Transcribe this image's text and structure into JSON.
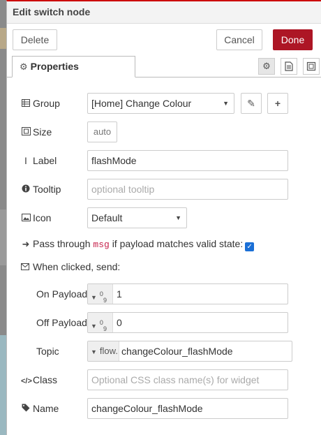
{
  "tray": {
    "title": "Edit switch node"
  },
  "toolbar": {
    "delete_label": "Delete",
    "cancel_label": "Cancel",
    "done_label": "Done"
  },
  "tabs": {
    "properties_label": "Properties",
    "icons": [
      "gear-icon",
      "description-icon",
      "appearance-icon"
    ]
  },
  "form": {
    "group": {
      "label": "Group",
      "value": "[Home] Change Colour"
    },
    "size": {
      "label": "Size",
      "value": "auto"
    },
    "label": {
      "label": "Label",
      "value": "flashMode"
    },
    "tooltip": {
      "label": "Tooltip",
      "placeholder": "optional tooltip"
    },
    "icon": {
      "label": "Icon",
      "value": "Default"
    },
    "passthrough": {
      "prefix": "Pass through",
      "code": "msg",
      "suffix": "if payload matches valid state:",
      "checked": true
    },
    "when_clicked": {
      "label": "When clicked, send:"
    },
    "on_payload": {
      "label": "On Payload",
      "type_sup": "0",
      "type_sub": "9",
      "value": "1"
    },
    "off_payload": {
      "label": "Off Payload",
      "type_sup": "0",
      "type_sub": "9",
      "value": "0"
    },
    "topic": {
      "label": "Topic",
      "type": "flow.",
      "value": "changeColour_flashMode"
    },
    "class": {
      "label": "Class",
      "placeholder": "Optional CSS class name(s) for widget"
    },
    "name": {
      "label": "Name",
      "value": "changeColour_flashMode"
    }
  },
  "colors": {
    "accent": "#ad1625",
    "checkbox": "#1a6fd6",
    "code": "#c7254e"
  }
}
